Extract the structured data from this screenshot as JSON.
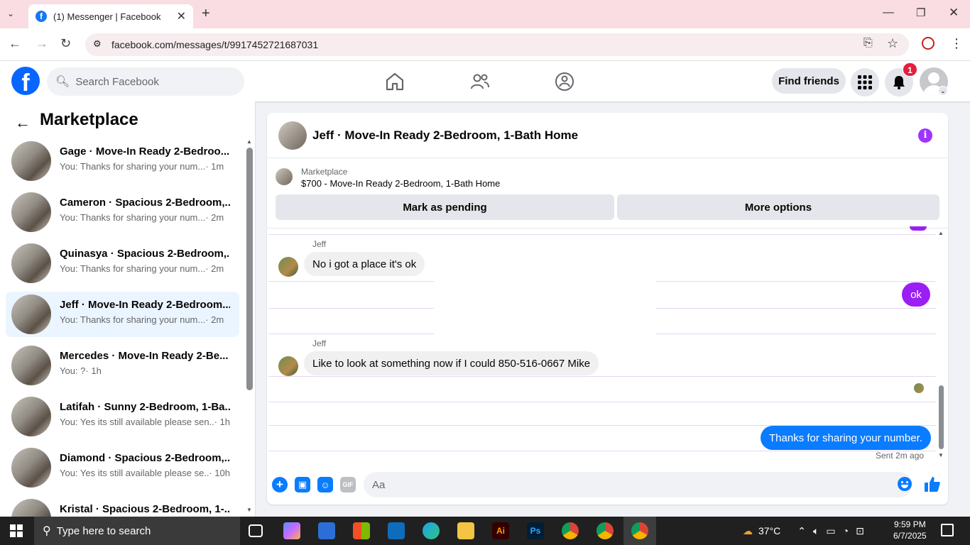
{
  "browser": {
    "tab_title": "(1) Messenger | Facebook",
    "url": "facebook.com/messages/t/9917452721687031"
  },
  "header": {
    "search_placeholder": "Search Facebook",
    "find_friends_label": "Find friends",
    "notification_count": "1"
  },
  "sidebar": {
    "title": "Marketplace",
    "conversations": [
      {
        "name": "Gage · Move-In Ready 2-Bedroo...",
        "snippet": "You: Thanks for sharing your num...",
        "time": " · 1m"
      },
      {
        "name": "Cameron · Spacious 2-Bedroom,...",
        "snippet": "You: Thanks for sharing your num...",
        "time": " · 2m"
      },
      {
        "name": "Quinasya · Spacious 2-Bedroom,...",
        "snippet": "You: Thanks for sharing your num...",
        "time": " · 2m"
      },
      {
        "name": "Jeff · Move-In Ready 2-Bedroom...",
        "snippet": "You: Thanks for sharing your num...",
        "time": " · 2m"
      },
      {
        "name": "Mercedes · Move-In Ready 2-Be...",
        "snippet": "You: ?",
        "time": " · 1h"
      },
      {
        "name": "Latifah · Sunny 2-Bedroom, 1-Ba...",
        "snippet": "You: Yes its still available please sen...",
        "time": " · 1h"
      },
      {
        "name": "Diamond · Spacious 2-Bedroom,...",
        "snippet": "You: Yes its still available please se...",
        "time": " · 10h"
      },
      {
        "name": "Kristal · Spacious 2-Bedroom, 1-...",
        "snippet": "",
        "time": ""
      }
    ]
  },
  "chat": {
    "title": "Jeff · Move-In Ready 2-Bedroom, 1-Bath Home",
    "listing_source": "Marketplace",
    "listing_title": "$700 - Move-In Ready 2-Bedroom, 1-Bath Home",
    "mark_pending_label": "Mark as pending",
    "more_options_label": "More options",
    "messages": [
      {
        "sender": "Jeff",
        "text": "No i got a place it's ok"
      },
      {
        "sender": "You",
        "text": "ok"
      },
      {
        "sender": "Jeff",
        "text": "Like to look at something now if I could 850-516-0667 Mike"
      },
      {
        "sender": "You",
        "text": "Thanks for sharing your number."
      }
    ],
    "sent_status": "Sent 2m ago",
    "composer_placeholder": "Aa",
    "gif_label": "GIF"
  },
  "taskbar": {
    "search_placeholder": "Type here to search",
    "weather": "37°C",
    "time": "9:59 PM",
    "date": "6/7/2025"
  },
  "colors": {
    "brand": "#0866ff",
    "outgoing_blue": "#0a7cff",
    "outgoing_purple": "#9b1ff5",
    "active_conv": "#ebf5ff"
  }
}
